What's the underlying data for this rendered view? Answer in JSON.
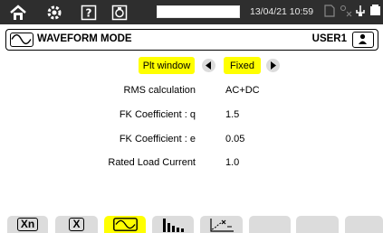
{
  "status_bar": {
    "icons": [
      "home-icon",
      "settings-icon",
      "help-icon",
      "screenshot-icon",
      "progress-bar",
      "memory-card-icon",
      "connection-icon",
      "usb-icon",
      "battery-icon"
    ],
    "datetime": "13/04/21 10:59"
  },
  "header": {
    "mode_title": "WAVEFORM MODE",
    "user": "USER1"
  },
  "form": {
    "plt_window": {
      "label": "Plt window",
      "value": "Fixed"
    },
    "rms_calculation": {
      "label": "RMS calculation",
      "value": "AC+DC"
    },
    "fk_q": {
      "label": "FK Coefficient : q",
      "value": "1.5"
    },
    "fk_e": {
      "label": "FK Coefficient : e",
      "value": "0.05"
    },
    "rated_load": {
      "label": "Rated Load Current",
      "value": "1.0"
    }
  },
  "tabs": [
    {
      "label": "Xn",
      "icon": "xn-icon",
      "active": false
    },
    {
      "label": "X",
      "icon": "x-icon",
      "active": false
    },
    {
      "label": "",
      "icon": "waveform-icon",
      "active": true
    },
    {
      "label": "",
      "icon": "harmonics-icon",
      "active": false
    },
    {
      "label": "",
      "icon": "chart-edit-icon",
      "active": false
    },
    {
      "label": "",
      "icon": "",
      "active": false
    },
    {
      "label": "",
      "icon": "",
      "active": false
    },
    {
      "label": "",
      "icon": "",
      "active": false
    }
  ],
  "colors": {
    "topbar": "#2e2e2e",
    "highlight": "#ffff00",
    "tab": "#dcdcdc"
  }
}
